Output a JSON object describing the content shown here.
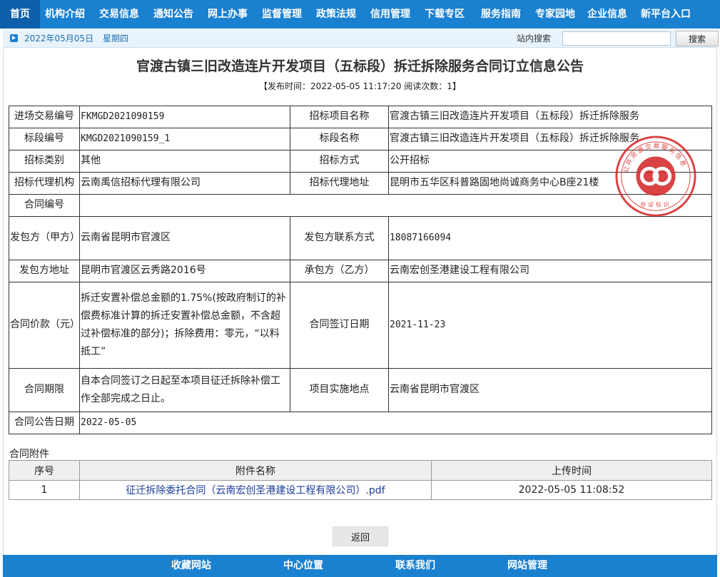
{
  "nav": {
    "items": [
      {
        "label": "首页"
      },
      {
        "label": "机构介绍"
      },
      {
        "label": "交易信息"
      },
      {
        "label": "通知公告"
      },
      {
        "label": "网上办事"
      },
      {
        "label": "监督管理"
      },
      {
        "label": "政策法规"
      },
      {
        "label": "信用管理"
      },
      {
        "label": "下载专区"
      },
      {
        "label": "服务指南"
      },
      {
        "label": "专家园地"
      },
      {
        "label": "企业信息"
      },
      {
        "label": "新平台入口"
      }
    ]
  },
  "subbar": {
    "date": "2022年05月05日",
    "weekday": "星期四",
    "search_label": "站内搜索",
    "search_value": "",
    "search_button": "搜索"
  },
  "title": "官渡古镇三旧改造连片开发项目（五标段）拆迁拆除服务合同订立信息公告",
  "publish_info": "【发布时间：2022-05-05 11:17:20  阅读次数：1】",
  "info": {
    "trade_no_label": "进场交易编号",
    "trade_no": "FKMGD2021090159",
    "project_name_label": "招标项目名称",
    "project_name": "官渡古镇三旧改造连片开发项目（五标段）拆迁拆除服务",
    "section_no_label": "标段编号",
    "section_no": "KMGD2021090159_1",
    "section_name_label": "标段名称",
    "section_name": "官渡古镇三旧改造连片开发项目（五标段）拆迁拆除服务",
    "category_label": "招标类别",
    "category": "其他",
    "method_label": "招标方式",
    "method": "公开招标",
    "agency_label": "招标代理机构",
    "agency": "云南禹信招标代理有限公司",
    "agency_addr_label": "招标代理地址",
    "agency_addr": "昆明市五华区科普路固地尚诚商务中心B座21楼",
    "contract_no_label": "合同编号",
    "contract_no": "",
    "employer_label": "发包方（甲方）",
    "employer": "云南省昆明市官渡区",
    "employer_contact_label": "发包方联系方式",
    "employer_contact": "18087166094",
    "employer_addr_label": "发包方地址",
    "employer_addr": "昆明市官渡区云秀路2016号",
    "contractor_label": "承包方（乙方）",
    "contractor": "云南宏创圣港建设工程有限公司",
    "price_label": "合同价款（元）",
    "price": "拆迁安置补偿总金额的1.75%(按政府制订的补偿费标准计算的拆迁安置补偿总金额，不含超过补偿标准的部分)；拆除费用：零元，“以料抵工”",
    "sign_date_label": "合同签订日期",
    "sign_date": "2021-11-23",
    "period_label": "合同期限",
    "period": "自本合同签订之日起至本项目征迁拆除补偿工作全部完成之日止。",
    "location_label": "项目实施地点",
    "location": "云南省昆明市官渡区",
    "announce_date_label": "合同公告日期",
    "announce_date": "2022-05-05"
  },
  "attachments": {
    "title": "合同附件",
    "headers": [
      "序号",
      "附件名称",
      "上传时间"
    ],
    "rows": [
      {
        "no": "1",
        "name": "征迁拆除委托合同（云南宏创圣港建设工程有限公司）.pdf",
        "time": "2022-05-05 11:08:52"
      }
    ]
  },
  "back_button": "返回",
  "footer": {
    "links": [
      {
        "label": "收藏网站"
      },
      {
        "label": "中心位置"
      },
      {
        "label": "联系我们"
      },
      {
        "label": "网站管理"
      }
    ]
  },
  "seal": {
    "color": "#d42a2a",
    "ring_text": "公共资源交易服务信息",
    "bottom_text": "存证标识"
  },
  "colors": {
    "nav_bg": "#1a80d0",
    "nav_active": "#0c5fa8",
    "subbar_bg": "#e8f3fb",
    "date_text": "#1e6fb0",
    "footer_bg": "#1a80d0"
  }
}
